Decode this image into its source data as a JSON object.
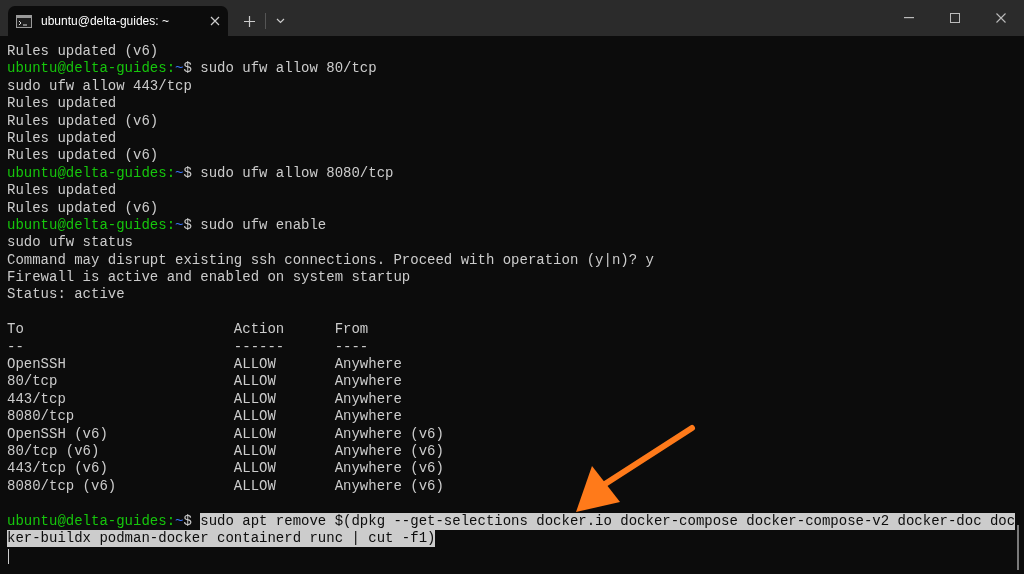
{
  "tab": {
    "title": "ubuntu@delta-guides: ~",
    "selected": true
  },
  "lines": [
    {
      "kind": "output",
      "text": "Rules updated (v6)"
    },
    {
      "kind": "prompt",
      "user_host": "ubuntu@delta-guides:",
      "path": "~",
      "symbol": "$",
      "command": "sudo ufw allow 80/tcp",
      "selected": false
    },
    {
      "kind": "output",
      "text": "sudo ufw allow 443/tcp"
    },
    {
      "kind": "output",
      "text": "Rules updated"
    },
    {
      "kind": "output",
      "text": "Rules updated (v6)"
    },
    {
      "kind": "output",
      "text": "Rules updated"
    },
    {
      "kind": "output",
      "text": "Rules updated (v6)"
    },
    {
      "kind": "prompt",
      "user_host": "ubuntu@delta-guides:",
      "path": "~",
      "symbol": "$",
      "command": "sudo ufw allow 8080/tcp",
      "selected": false
    },
    {
      "kind": "output",
      "text": "Rules updated"
    },
    {
      "kind": "output",
      "text": "Rules updated (v6)"
    },
    {
      "kind": "prompt",
      "user_host": "ubuntu@delta-guides:",
      "path": "~",
      "symbol": "$",
      "command": "sudo ufw enable",
      "selected": false
    },
    {
      "kind": "output",
      "text": "sudo ufw status"
    },
    {
      "kind": "output",
      "text": "Command may disrupt existing ssh connections. Proceed with operation (y|n)? y"
    },
    {
      "kind": "output",
      "text": "Firewall is active and enabled on system startup"
    },
    {
      "kind": "output",
      "text": "Status: active"
    },
    {
      "kind": "blank"
    },
    {
      "kind": "output",
      "text": "To                         Action      From"
    },
    {
      "kind": "output",
      "text": "--                         ------      ----"
    },
    {
      "kind": "output",
      "text": "OpenSSH                    ALLOW       Anywhere"
    },
    {
      "kind": "output",
      "text": "80/tcp                     ALLOW       Anywhere"
    },
    {
      "kind": "output",
      "text": "443/tcp                    ALLOW       Anywhere"
    },
    {
      "kind": "output",
      "text": "8080/tcp                   ALLOW       Anywhere"
    },
    {
      "kind": "output",
      "text": "OpenSSH (v6)               ALLOW       Anywhere (v6)"
    },
    {
      "kind": "output",
      "text": "80/tcp (v6)                ALLOW       Anywhere (v6)"
    },
    {
      "kind": "output",
      "text": "443/tcp (v6)               ALLOW       Anywhere (v6)"
    },
    {
      "kind": "output",
      "text": "8080/tcp (v6)              ALLOW       Anywhere (v6)"
    },
    {
      "kind": "blank"
    },
    {
      "kind": "prompt",
      "user_host": "ubuntu@delta-guides:",
      "path": "~",
      "symbol": "$",
      "command": "sudo apt remove $(dpkg --get-selections docker.io docker-compose docker-compose-v2 docker-doc doc",
      "selected": true
    },
    {
      "kind": "output",
      "text": "ker-buildx podman-docker containerd runc | cut -f1)",
      "selected": true
    },
    {
      "kind": "cursor"
    }
  ]
}
